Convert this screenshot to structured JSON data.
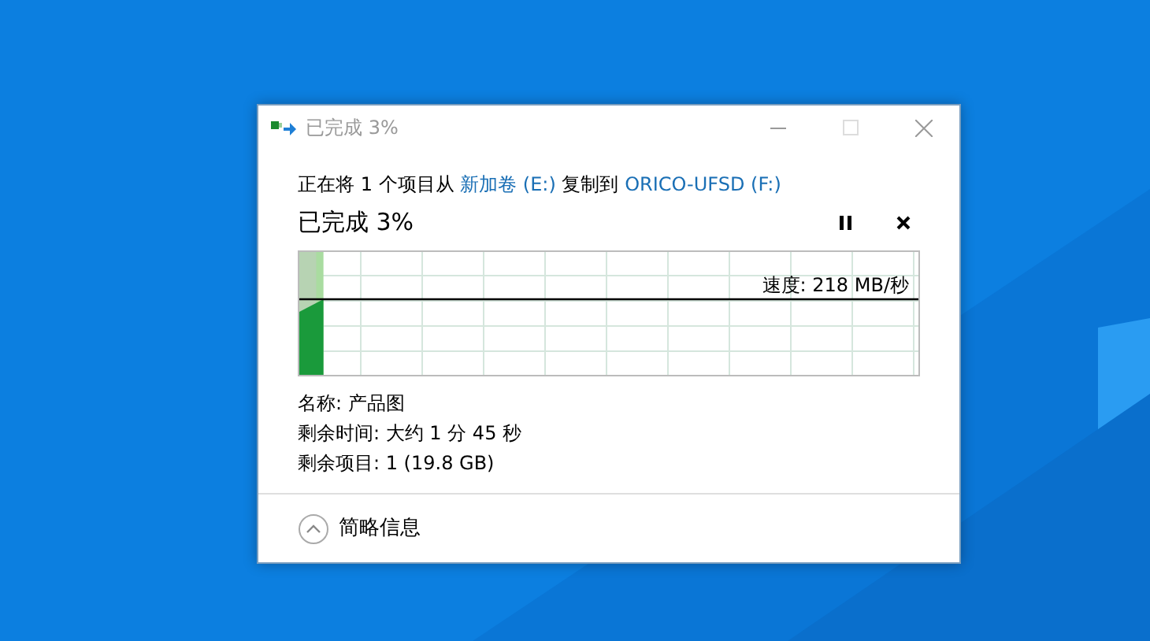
{
  "window": {
    "title": "已完成 3%",
    "active": false,
    "maximize_disabled": true
  },
  "description": [
    {
      "kind": "text",
      "text": "正在将 1 个项目从"
    },
    {
      "kind": "link",
      "text": "新加卷 (E:)"
    },
    {
      "kind": "text",
      "text": "复制到"
    },
    {
      "kind": "link",
      "text": "ORICO-UFSD (F:)"
    }
  ],
  "heading": "已完成 3%",
  "progress": {
    "level": 0.03,
    "speed": "速度: 218 MB/秒"
  },
  "details": [
    "名称: 产品图",
    "剩余时间: 大约 1 分 45 秒",
    "剩余项目: 1 (19.8 GB)"
  ],
  "toggle": {
    "label": "简略信息",
    "expanded": true
  }
}
